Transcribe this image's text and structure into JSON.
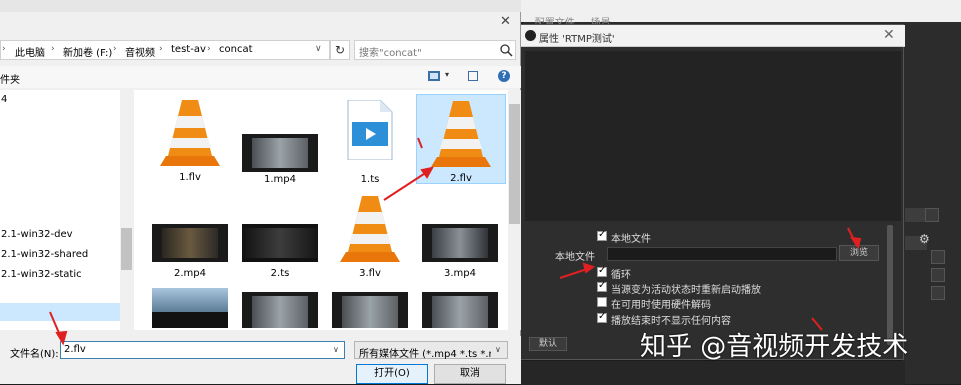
{
  "file_dialog": {
    "address": {
      "crumbs": [
        "此电脑",
        "新加卷 (F:)",
        "音视频",
        "test-av",
        "concat"
      ],
      "separator": "›",
      "dropdown": "∨"
    },
    "refresh": "↻",
    "search_placeholder": "搜索\"concat\"",
    "toolbar": {
      "new_folder": "件夹",
      "view_dropdown": "▾",
      "help": "?"
    },
    "close": "✕",
    "nav_items": [
      "4",
      "2.1-win32-dev",
      "2.1-win32-shared",
      "2.1-win32-static"
    ],
    "files": [
      {
        "name": "1.flv",
        "kind": "vlc"
      },
      {
        "name": "1.mp4",
        "kind": "video"
      },
      {
        "name": "1.ts",
        "kind": "ts"
      },
      {
        "name": "2.flv",
        "kind": "vlc",
        "selected": true
      },
      {
        "name": "2.mp4",
        "kind": "video"
      },
      {
        "name": "2.ts",
        "kind": "video"
      },
      {
        "name": "3.flv",
        "kind": "vlc"
      },
      {
        "name": "3.mp4",
        "kind": "video"
      }
    ],
    "filename_label": "文件名(N):",
    "filename_value": "2.flv",
    "file_type": "所有媒体文件 (*.mp4 *.ts *.mo",
    "open_button": "打开(O)",
    "cancel_button": "取消"
  },
  "obs": {
    "background_title": "... 配置文件 ... 场景 ...",
    "prop_title": "属性 'RTMP测试'",
    "close": "✕",
    "local_file_checkbox": "本地文件",
    "local_file_label": "本地文件",
    "browse_button": "浏览",
    "options": [
      {
        "label": "循环",
        "checked": true
      },
      {
        "label": "当源变为活动状态时重新启动播放",
        "checked": true
      },
      {
        "label": "在可用时使用硬件解码",
        "checked": false
      },
      {
        "label": "播放结束时不显示任何内容",
        "checked": true
      }
    ],
    "default_button": "默认"
  },
  "watermark": "知乎 @音视频开发技术",
  "colors": {
    "accent": "#0078d7",
    "selection": "#cce8ff",
    "arrow": "#e02020",
    "obs_dark": "#2e2e2e"
  }
}
